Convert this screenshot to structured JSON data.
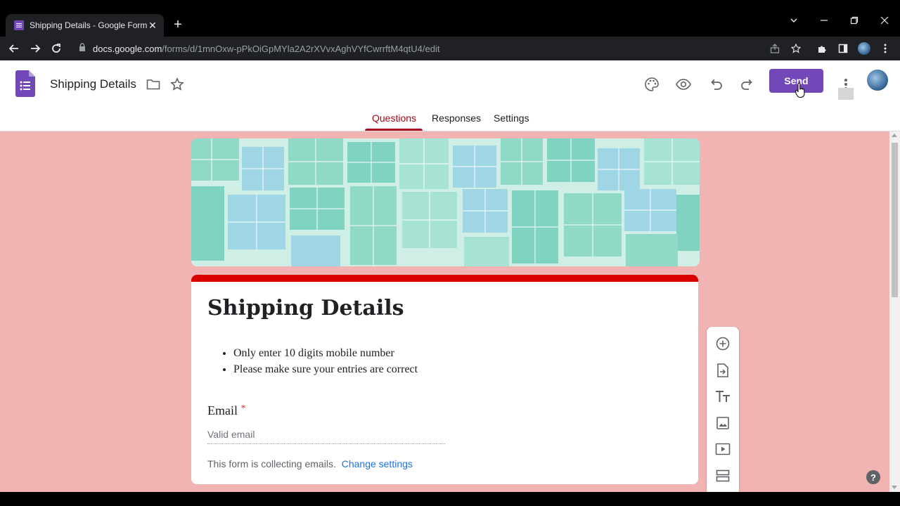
{
  "browser": {
    "tab_title": "Shipping Details - Google Forms",
    "tab_close": "✕",
    "new_tab": "+",
    "url_domain": "docs.google.com",
    "url_path": "/forms/d/1mnOxw-pPkOiGpMYla2A2rXVvxAghVYfCwrrftM4qtU4/edit"
  },
  "app": {
    "doc_title": "Shipping Details",
    "send_label": "Send",
    "tabs": [
      {
        "label": "Questions",
        "active": true
      },
      {
        "label": "Responses",
        "active": false
      },
      {
        "label": "Settings",
        "active": false
      }
    ],
    "accent_color": "#7248b9",
    "theme_red": "#db0000"
  },
  "form": {
    "title": "Shipping Details",
    "description": [
      "Only enter 10 digits mobile number",
      "Please make sure your entries are correct"
    ],
    "email_label": "Email",
    "required_mark": "*",
    "email_placeholder": "Valid email",
    "collecting_note": "This form is collecting emails.",
    "change_settings": "Change settings"
  },
  "sidetools": [
    "add-question-icon",
    "import-questions-icon",
    "add-title-icon",
    "add-image-icon",
    "add-video-icon",
    "add-section-icon"
  ],
  "help_label": "?"
}
